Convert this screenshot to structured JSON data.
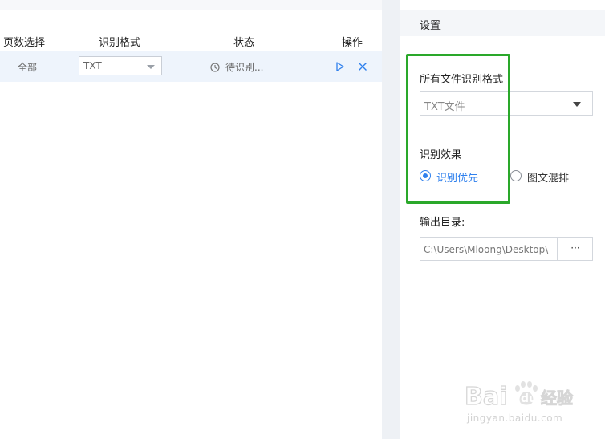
{
  "table": {
    "headers": {
      "pages": "页数选择",
      "format": "识别格式",
      "status": "状态",
      "actions": "操作"
    },
    "rows": [
      {
        "pages": "全部",
        "format": "TXT",
        "status": "待识别..."
      }
    ]
  },
  "settings": {
    "title": "设置",
    "all_format_label": "所有文件识别格式",
    "all_format_value": "TXT文件",
    "effect_label": "识别效果",
    "effect_options": [
      {
        "label": "识别优先",
        "selected": true
      },
      {
        "label": "图文混排",
        "selected": false
      }
    ],
    "output_label": "输出目录:",
    "output_path": "C:\\Users\\Mloong\\Desktop\\",
    "browse_label": "···"
  },
  "watermark": {
    "logo_text_1": "Bai",
    "logo_text_2": "du",
    "logo_text_3": "经验",
    "site": "jingyan.baidu.com"
  },
  "colors": {
    "accent": "#2f80ed",
    "highlight": "#2aa82a",
    "row_bg": "#eef4fc"
  },
  "icons": [
    "clock-icon",
    "play-icon",
    "close-icon",
    "dropdown-arrow-icon",
    "ellipsis-icon",
    "paw-icon"
  ]
}
